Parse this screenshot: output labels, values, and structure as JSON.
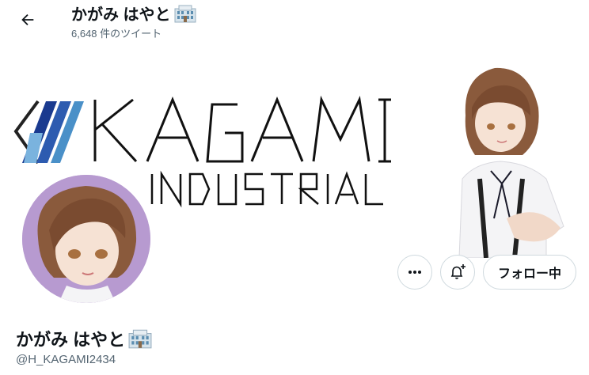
{
  "header": {
    "back_icon": "arrow-left-icon",
    "title": "かがみ はやと",
    "title_emoji_icon": "office-building-icon",
    "tweet_count": "6,648 件のツイート"
  },
  "banner": {
    "logo_main": "KAGAMI",
    "logo_sub": "INDUSTRIAL",
    "logo_colors": [
      "#1a3a8f",
      "#4a90c8",
      "#222222"
    ]
  },
  "profile": {
    "display_name": "かがみ はやと",
    "name_emoji_icon": "office-building-icon",
    "handle": "@H_KAGAMI2434",
    "avatar_bg": "#b79ad0"
  },
  "actions": {
    "more_icon": "more-dots-icon",
    "notify_icon": "bell-plus-icon",
    "follow_label": "フォロー中"
  }
}
